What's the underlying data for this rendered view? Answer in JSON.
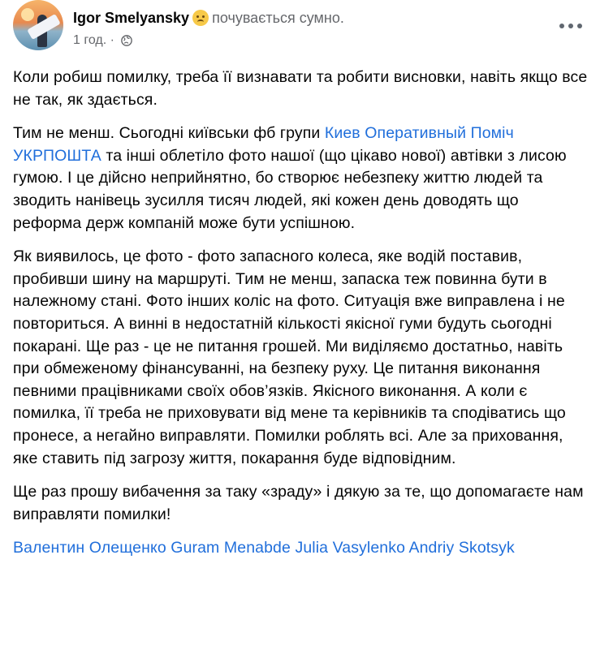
{
  "header": {
    "author": "Igor Smelyansky",
    "feeling": "почувається сумно.",
    "time": "1 год.",
    "separator": "·",
    "icons": [
      "sad-emoji-icon",
      "globe-icon",
      "more-dots-icon"
    ]
  },
  "post": {
    "p1": "Коли робиш помилку, треба її визнавати та робити висновки, навіть якщо все не так, як здається.",
    "p2_before": "Тим не менш. Сьогодні київськи фб групи ",
    "p2_link": "Киев Оперативный Поміч УКРПОШТА",
    "p2_after": " та інші облетіло фото нашої (що цікаво нової) автівки з лисою гумою. І це дійсно неприйнятно, бо створює небезпеку життю людей та зводить нанівець зусилля тисяч людей, які кожен день доводять що реформа держ компаній може бути успішною.",
    "p3": "Як виявилось, це фото - фото запасного колеса, яке водій поставив, пробивши шину на маршруті. Тим не менш, запаска теж повинна бути в належному стані. Фото інших коліс на фото. Ситуація вже виправлена і не повториться. А винні в недостатній кількості якісної гуми будуть сьогодні покарані. Ще раз - це не питання грошей. Ми виділяємо достатньо, навіть при обмеженому фінансуванні, на безпеку руху. Це питання виконання певними працівниками своїх обов’язків. Якісного виконання. А коли є помилка, її треба не приховувати від мене та керівників та сподіватись що пронесе, а негайно виправляти. Помилки роблять всі. Але за приховання, яке ставить під загрозу життя, покарання буде відповідним.",
    "p4": "Ще раз прошу вибачення за таку «зраду» і дякую за те, що допомагаєте нам виправляти помилки!",
    "tags": [
      "Валентин Олещенко",
      "Guram Menabde",
      "Julia Vasylenko",
      "Andriy Skotsyk"
    ]
  },
  "colors": {
    "link": "#216fdb",
    "meta": "#65676b",
    "text": "#050505"
  }
}
